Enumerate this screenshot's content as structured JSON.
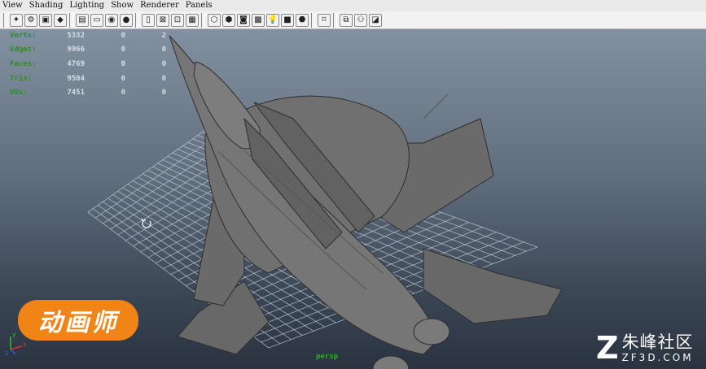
{
  "menu": [
    "View",
    "Shading",
    "Lighting",
    "Show",
    "Renderer",
    "Panels"
  ],
  "toolbar_groups": [
    [
      {
        "icon": "select-camera-icon",
        "glyph": "✦"
      },
      {
        "icon": "lock-camera-icon",
        "glyph": "⚙"
      },
      {
        "icon": "camera-attributes-icon",
        "glyph": "▣"
      },
      {
        "icon": "bookmark-icon",
        "glyph": "◆"
      }
    ],
    [
      {
        "icon": "image-plane-icon",
        "glyph": "▤"
      },
      {
        "icon": "two-d-pan-zoom-icon",
        "glyph": "▭"
      },
      {
        "icon": "grease-pencil-icon",
        "glyph": "◉"
      },
      {
        "icon": "grid-toggle-icon",
        "glyph": "●"
      }
    ],
    [
      {
        "icon": "film-gate-icon",
        "glyph": "▯"
      },
      {
        "icon": "resolution-gate-icon",
        "glyph": "⊠"
      },
      {
        "icon": "gate-mask-icon",
        "glyph": "⊡"
      },
      {
        "icon": "field-chart-icon",
        "glyph": "▦"
      }
    ],
    [
      {
        "icon": "wireframe-icon",
        "glyph": "⬡"
      },
      {
        "icon": "smooth-shade-icon",
        "glyph": "⬢"
      },
      {
        "icon": "wireframe-on-shaded-icon",
        "glyph": "◙"
      },
      {
        "icon": "textured-icon",
        "glyph": "▩"
      },
      {
        "icon": "use-all-lights-icon",
        "glyph": "💡"
      },
      {
        "icon": "shadows-icon",
        "glyph": "■"
      },
      {
        "icon": "high-quality-icon",
        "glyph": "⬣"
      }
    ],
    [
      {
        "icon": "isolate-select-icon",
        "glyph": "⌑"
      }
    ],
    [
      {
        "icon": "xray-icon",
        "glyph": "⧉"
      },
      {
        "icon": "xray-joints-icon",
        "glyph": "⚇"
      },
      {
        "icon": "xray-components-icon",
        "glyph": "◪"
      }
    ]
  ],
  "hud": {
    "rows": [
      {
        "label": "Verts:",
        "v1": "5332",
        "v2": "0",
        "v3": "2"
      },
      {
        "label": "Edges:",
        "v1": "9966",
        "v2": "0",
        "v3": "0"
      },
      {
        "label": "Faces:",
        "v1": "4769",
        "v2": "0",
        "v3": "0"
      },
      {
        "label": "Tris:",
        "v1": "9504",
        "v2": "0",
        "v3": "0"
      },
      {
        "label": "UVs:",
        "v1": "7451",
        "v2": "0",
        "v3": "0"
      }
    ]
  },
  "camera_label": "persp",
  "axes": {
    "x": "x",
    "y": "y",
    "z": "z"
  },
  "badge_text": "动画师",
  "watermark": {
    "mark": "Z",
    "cn": "朱峰社区",
    "en": "ZF3D.COM"
  },
  "colors": {
    "hud_label": "#2c8f1f",
    "hud_value": "#d6dde4",
    "badge": "#f08416",
    "model": "#6f6f6f",
    "model_edge": "#2e2e2e",
    "grid": "#c8d3de"
  }
}
